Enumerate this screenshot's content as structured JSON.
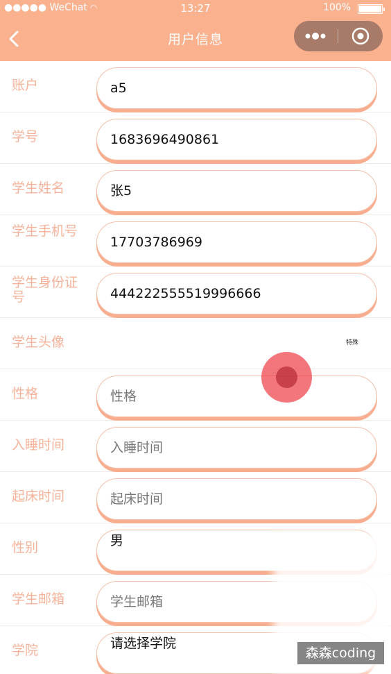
{
  "status_bar": {
    "carrier": "●●●●● WeChat",
    "time": "13:27",
    "battery": "100%"
  },
  "nav": {
    "title": "用户信息"
  },
  "form": {
    "rows": [
      {
        "label": "账户",
        "value": "a5"
      },
      {
        "label": "学号",
        "value": "1683696490861"
      },
      {
        "label": "学生姓名",
        "value": "张5"
      },
      {
        "label": "学生手机号",
        "value": "17703786969"
      },
      {
        "label": "学生身份证号",
        "value": "444222555519996666"
      },
      {
        "label": "学生头像",
        "avatar_text": "特殊"
      },
      {
        "label": "性格",
        "placeholder": "性格"
      },
      {
        "label": "入睡时间",
        "placeholder": "入睡时间"
      },
      {
        "label": "起床时间",
        "placeholder": "起床时间"
      },
      {
        "label": "性别",
        "value": "男"
      },
      {
        "label": "学生邮箱",
        "placeholder": "学生邮箱"
      },
      {
        "label": "学院",
        "value": "请选择学院"
      }
    ]
  },
  "watermark": "森森coding",
  "colors": {
    "accent": "#f9b18e",
    "label": "#f6b39a",
    "capsule": "#a77b67"
  }
}
